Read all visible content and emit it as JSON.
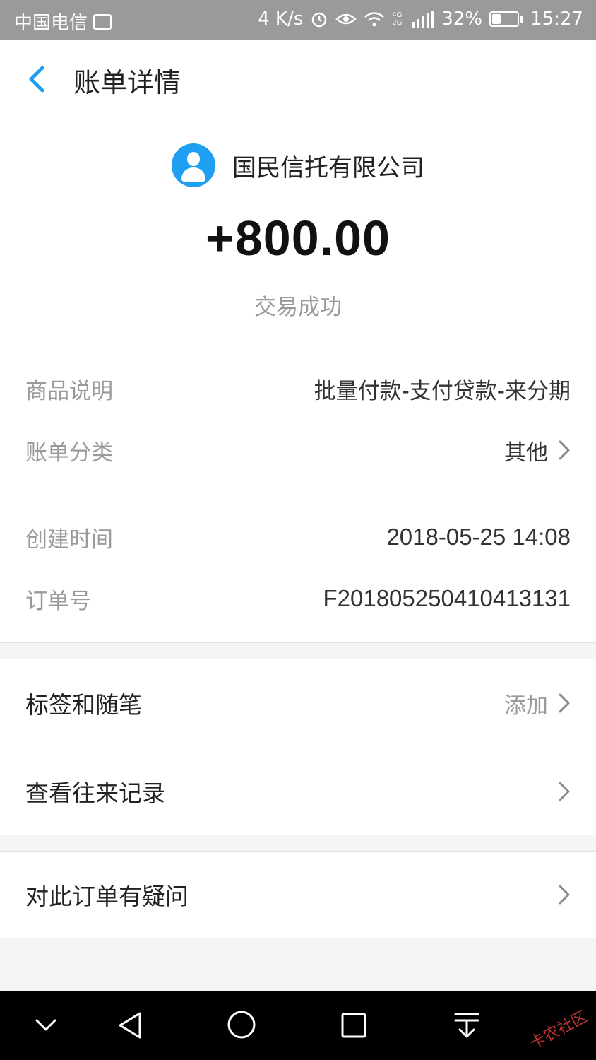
{
  "status_bar": {
    "carrier": "中国电信",
    "net_speed": "4 K/s",
    "network_type": "4G 2G",
    "battery": "32%",
    "time": "15:27"
  },
  "header": {
    "title": "账单详情"
  },
  "summary": {
    "payee": "国民信托有限公司",
    "amount": "+800.00",
    "status": "交易成功"
  },
  "details": {
    "item_desc_label": "商品说明",
    "item_desc_value": "批量付款-支付贷款-来分期",
    "category_label": "账单分类",
    "category_value": "其他",
    "created_label": "创建时间",
    "created_value": "2018-05-25 14:08",
    "order_label": "订单号",
    "order_value": "F20180525041041313​1"
  },
  "actions": {
    "tags_label": "标签和随笔",
    "tags_action": "添加",
    "history_label": "查看往来记录",
    "question_label": "对此订单有疑问"
  },
  "watermark": "卡农社区",
  "colors": {
    "accent": "#1e9ff2",
    "status_bar": "#9a9a9a",
    "nav_bar": "#000000"
  }
}
